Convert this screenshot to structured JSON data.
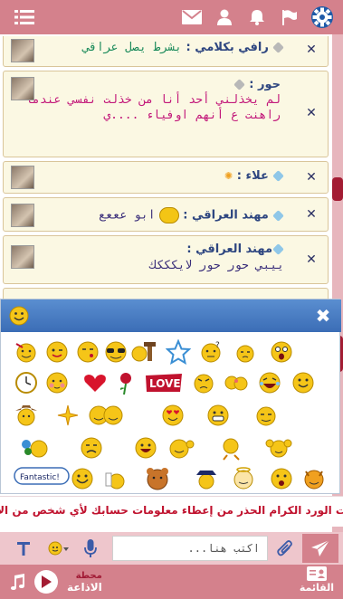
{
  "topbar": {
    "icons": [
      "gear-icon",
      "flag-icon",
      "bell-icon",
      "user-icon",
      "mail-icon",
      "menu-icon"
    ],
    "color": "#d4818c"
  },
  "messages": [
    {
      "nick": "رافي بكلامي",
      "text": "بشرط يصل عراقي",
      "badge": "grey",
      "text_color": "green"
    },
    {
      "nick": "حور",
      "text": "لم يخذلني أحد أنا من خذلت نفسي عندما راهنت ع أنهم اوفياء ....ي",
      "badge": "grey",
      "text_color": "pink"
    },
    {
      "nick": "علاء",
      "text": "",
      "badge": "blue",
      "text_color": "navy"
    },
    {
      "nick": "مهند العراقي",
      "text": "ابو عععع",
      "badge": "blue",
      "text_color": "purple"
    },
    {
      "nick": "مهند العراقي",
      "text": "ييبي حور حور لايكككك",
      "badge": "blue",
      "text_color": "purple"
    }
  ],
  "emoji_panel": {
    "close": "✖",
    "fantastic_label": "Fantastic!",
    "love_label": "LOVE"
  },
  "notice": "ت الورد الكرام الحذر من إعطاء معلومات حسابك لأي شخص من الأ",
  "composer": {
    "placeholder": "اكتب هنا..."
  },
  "bottom": {
    "station_label": "محطة",
    "radio_label": "الاذاعة",
    "list_label": "القائمة"
  },
  "colors": {
    "accent": "#d4818c",
    "dark_accent": "#a31c33",
    "panel_blue": "#3b6db6",
    "notice_red": "#c0122e"
  }
}
